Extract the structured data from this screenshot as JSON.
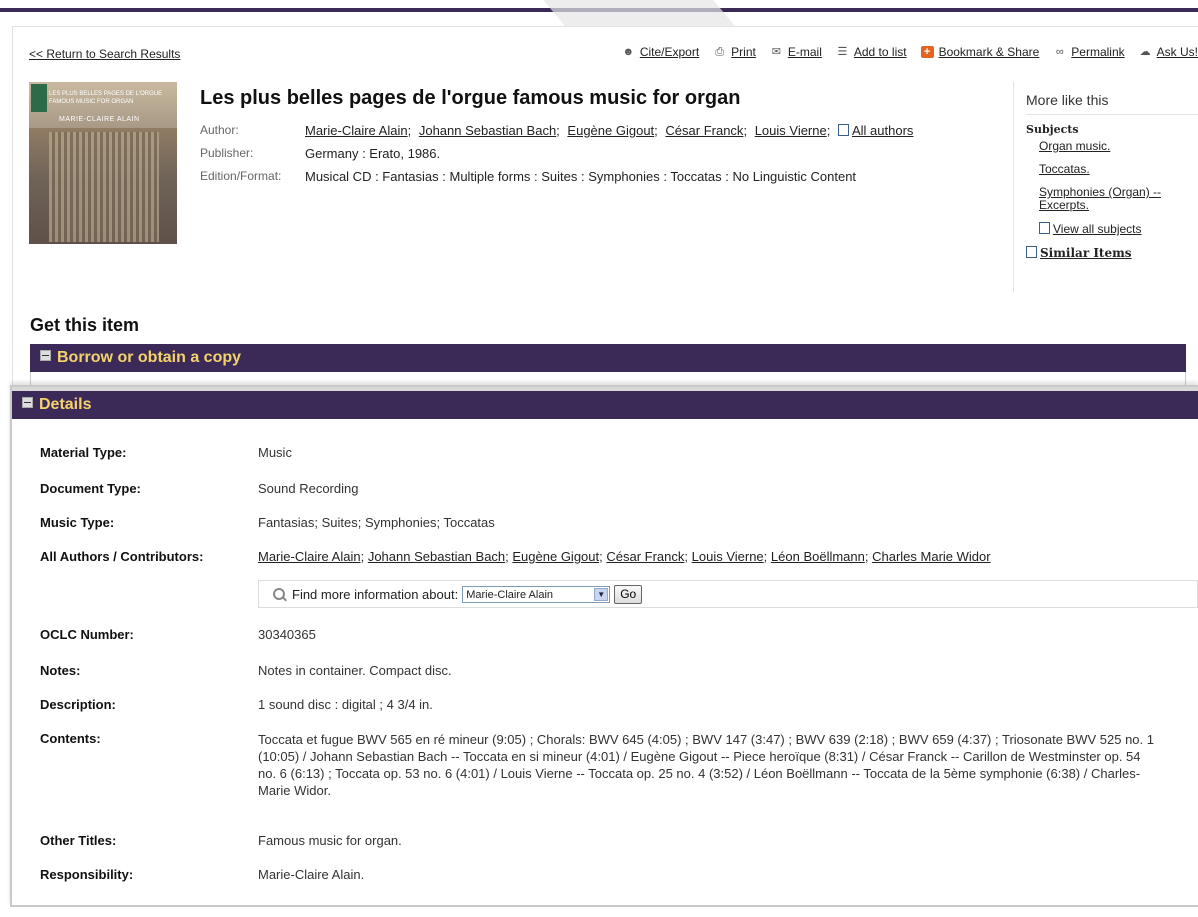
{
  "nav": {
    "return_label": "<< Return to Search Results"
  },
  "toolbar": {
    "cite": "Cite/Export",
    "print": "Print",
    "email": "E-mail",
    "addlist": "Add to list",
    "bookmark": "Bookmark & Share",
    "permalink": "Permalink",
    "ask": "Ask Us!"
  },
  "item": {
    "title": "Les plus belles pages de l'orgue famous music for organ",
    "cover_title": "LES PLUS BELLES PAGES DE L'ORGUE FAMOUS MUSIC FOR ORGAN",
    "cover_name": "MARIE-CLAIRE ALAIN",
    "author_label": "Author:",
    "authors": [
      "Marie-Claire Alain",
      "Johann Sebastian Bach",
      "Eugène Gigout",
      "César Franck",
      "Louis Vierne"
    ],
    "all_authors": "All authors",
    "publisher_label": "Publisher:",
    "publisher": "Germany : Erato, 1986.",
    "edition_label": "Edition/Format:",
    "edition": "Musical CD : Fantasias : Multiple forms : Suites : Symphonies : Toccatas : No Linguistic Content"
  },
  "more": {
    "heading": "More like this",
    "subjects_label": "Subjects",
    "subjects": [
      "Organ music.",
      "Toccatas.",
      "Symphonies (Organ) -- Excerpts."
    ],
    "view_all": "View all subjects",
    "similar": "Similar Items"
  },
  "get": {
    "heading": "Get this item",
    "borrow": "Borrow or obtain a copy"
  },
  "details": {
    "heading": "Details",
    "material_label": "Material Type:",
    "material": "Music",
    "document_label": "Document Type:",
    "document": "Sound Recording",
    "music_label": "Music Type:",
    "music": "Fantasias; Suites; Symphonies; Toccatas",
    "contributors_label": "All Authors / Contributors:",
    "contributors": [
      "Marie-Claire Alain",
      "Johann Sebastian Bach",
      "Eugène Gigout",
      "César Franck",
      "Louis Vierne",
      "Léon Boëllmann",
      "Charles Marie Widor"
    ],
    "find_label": "Find more information about:",
    "find_selected": "Marie-Claire Alain",
    "go": "Go",
    "oclc_label": "OCLC Number:",
    "oclc": "30340365",
    "notes_label": "Notes:",
    "notes": "Notes in container. Compact disc.",
    "description_label": "Description:",
    "description": "1 sound disc : digital ; 4 3/4 in.",
    "contents_label": "Contents:",
    "contents": "Toccata et fugue BWV 565 en ré mineur (9:05) ; Chorals: BWV 645 (4:05) ; BWV 147 (3:47) ; BWV 639 (2:18) ; BWV 659 (4:37) ; Triosonate BWV 525 no. 1 (10:05) / Johann Sebastian Bach -- Toccata en si mineur (4:01) / Eugène Gigout -- Piece heroïque (8:31) / César Franck -- Carillon de Westminster op. 54 no. 6 (6:13) ; Toccata op. 53 no. 6 (4:01) / Louis Vierne -- Toccata op. 25 no. 4 (3:52) / Léon Boëllmann -- Toccata de la 5ème symphonie (6:38) / Charles-Marie Widor.",
    "other_label": "Other Titles:",
    "other": "Famous music for organ.",
    "resp_label": "Responsibility:",
    "resp": "Marie-Claire Alain."
  }
}
